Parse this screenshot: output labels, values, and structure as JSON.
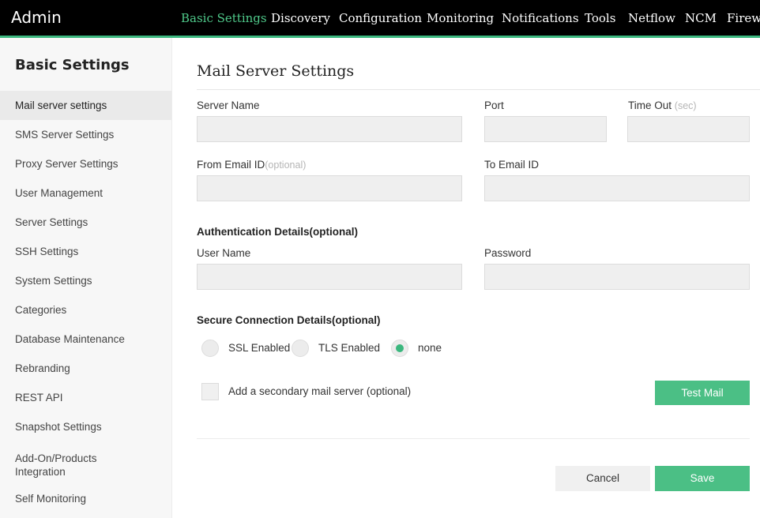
{
  "topbar": {
    "brand": "Admin",
    "nav": [
      {
        "label": "Basic Settings",
        "active": true
      },
      {
        "label": "Discovery"
      },
      {
        "label": "Configuration"
      },
      {
        "label": "Monitoring"
      },
      {
        "label": "Notifications"
      },
      {
        "label": "Tools"
      },
      {
        "label": "Netflow"
      },
      {
        "label": "NCM"
      },
      {
        "label": "Firewa"
      }
    ]
  },
  "sidebar": {
    "title": "Basic Settings",
    "items": [
      {
        "label": "Mail server settings",
        "active": true
      },
      {
        "label": "SMS Server Settings"
      },
      {
        "label": "Proxy Server Settings"
      },
      {
        "label": "User Management"
      },
      {
        "label": "Server Settings"
      },
      {
        "label": "SSH Settings"
      },
      {
        "label": "System Settings"
      },
      {
        "label": "Categories"
      },
      {
        "label": "Database Maintenance"
      },
      {
        "label": "Rebranding"
      },
      {
        "label": "REST API"
      },
      {
        "label": "Snapshot Settings"
      },
      {
        "label": "Add-On/Products Integration"
      },
      {
        "label": "Self Monitoring"
      }
    ]
  },
  "main": {
    "title": "Mail Server Settings",
    "fields": {
      "server_name": {
        "label": "Server Name",
        "value": ""
      },
      "port": {
        "label": "Port",
        "value": ""
      },
      "timeout": {
        "label": "Time Out",
        "hint": "(sec)",
        "value": ""
      },
      "from_email": {
        "label": "From Email ID",
        "hint": "(optional)",
        "value": ""
      },
      "to_email": {
        "label": "To Email ID",
        "value": ""
      },
      "username": {
        "label": "User Name",
        "value": ""
      },
      "password": {
        "label": "Password",
        "value": ""
      }
    },
    "auth_section": "Authentication Details(optional)",
    "secure_section": "Secure Connection Details(optional)",
    "secure_options": [
      {
        "label": "SSL Enabled",
        "checked": false
      },
      {
        "label": "TLS Enabled",
        "checked": false
      },
      {
        "label": "none",
        "checked": true
      }
    ],
    "secondary_label": "Add a secondary mail server (optional)",
    "secondary_checked": false,
    "test_mail_label": "Test Mail",
    "cancel_label": "Cancel",
    "save_label": "Save"
  },
  "colors": {
    "accent": "#3bb77e",
    "topbar": "#000000",
    "sidebar_bg": "#f7f7f7"
  }
}
